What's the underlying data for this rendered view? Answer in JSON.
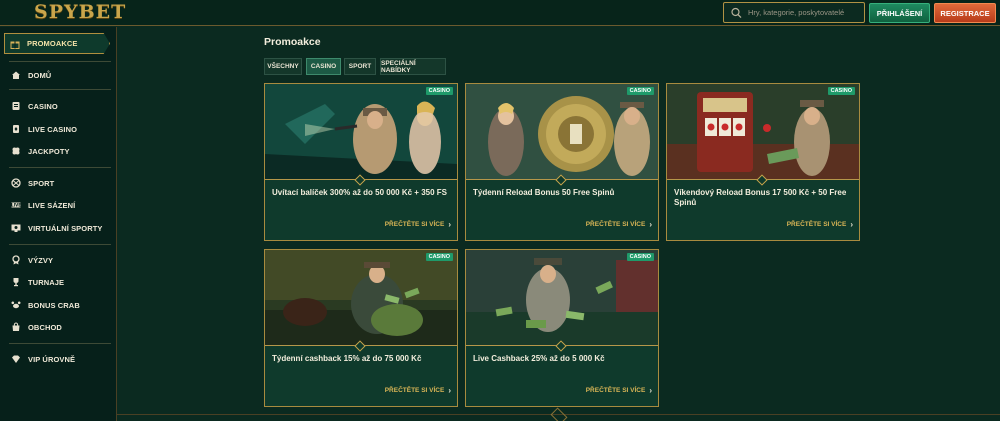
{
  "header": {
    "logo": "SPYBET",
    "search_placeholder": "Hry, kategorie, poskytovatelé",
    "login_label": "PŘIHLÁŠENÍ",
    "register_label": "REGISTRACE"
  },
  "sidebar": {
    "promo": {
      "label": "PROMOAKCE",
      "icon": "gift-icon"
    },
    "groups": [
      [
        {
          "label": "DOMŮ",
          "icon": "home-icon"
        }
      ],
      [
        {
          "label": "CASINO",
          "icon": "casino-icon"
        },
        {
          "label": "LIVE CASINO",
          "icon": "live-casino-icon"
        },
        {
          "label": "JACKPOTY",
          "icon": "clover-icon"
        }
      ],
      [
        {
          "label": "SPORT",
          "icon": "ball-icon"
        },
        {
          "label": "LIVE SÁZENÍ",
          "icon": "live-icon"
        },
        {
          "label": "VIRTUÁLNÍ SPORTY",
          "icon": "virtual-sports-icon"
        }
      ],
      [
        {
          "label": "VÝZVY",
          "icon": "medal-icon"
        },
        {
          "label": "TURNAJE",
          "icon": "trophy-icon"
        },
        {
          "label": "BONUS CRAB",
          "icon": "crab-icon"
        },
        {
          "label": "OBCHOD",
          "icon": "shop-icon"
        }
      ],
      [
        {
          "label": "VIP ÚROVNĚ",
          "icon": "diamond-icon"
        }
      ]
    ]
  },
  "main": {
    "title": "Promoakce",
    "tabs": [
      {
        "label": "VŠECHNY",
        "active": false
      },
      {
        "label": "CASINO",
        "active": true
      },
      {
        "label": "SPORT",
        "active": false
      },
      {
        "label": "SPECIÁLNÍ NABÍDKY",
        "active": false
      }
    ],
    "cards": [
      {
        "title": "Uvítací balíček 300% až do 50 000 Kč + 350 FS",
        "badge": "CASINO",
        "more": "PŘEČTĚTE SI VÍCE"
      },
      {
        "title": "Týdenní Reload Bonus 50 Free Spinů",
        "badge": "CASINO",
        "more": "PŘEČTĚTE SI VÍCE"
      },
      {
        "title": "Víkendový Reload Bonus 17 500 Kč + 50 Free Spinů",
        "badge": "CASINO",
        "more": "PŘEČTĚTE SI VÍCE"
      },
      {
        "title": "Týdenní cashback 15% až do 75 000 Kč",
        "badge": "CASINO",
        "more": "PŘEČTĚTE SI VÍCE"
      },
      {
        "title": "Live Cashback 25% až do 5 000 Kč",
        "badge": "CASINO",
        "more": "PŘEČTĚTE SI VÍCE"
      }
    ]
  },
  "colors": {
    "background": "#0b2a20",
    "gold": "#c9a54b",
    "login_green": "#1e8a60",
    "register_orange": "#e06a3a",
    "badge_green": "#1f9a6a"
  }
}
